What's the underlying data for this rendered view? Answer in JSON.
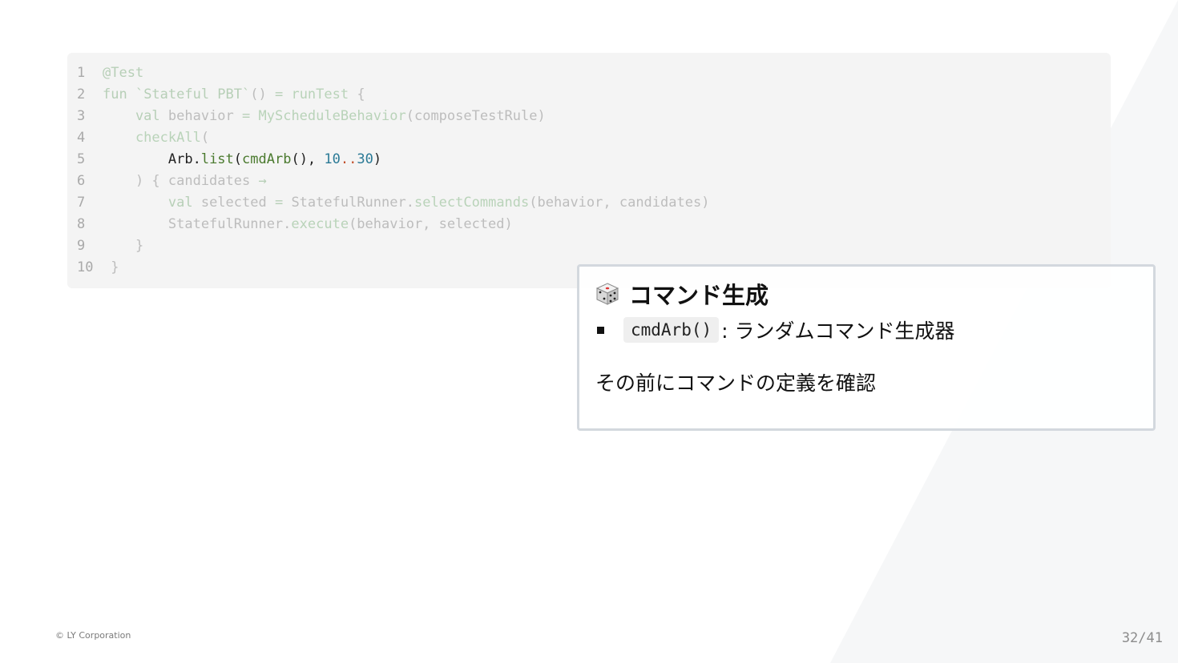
{
  "slide": {
    "copyright": "© LY Corporation",
    "page_number": "32/41"
  },
  "code": {
    "lines": [
      {
        "n": "1",
        "tokens": [
          {
            "t": "@Test",
            "c": "dimk"
          }
        ]
      },
      {
        "n": "2",
        "tokens": [
          {
            "t": "fun ",
            "c": "dimk"
          },
          {
            "t": "`Stateful PBT`",
            "c": "dimk"
          },
          {
            "t": "() ",
            "c": "dim"
          },
          {
            "t": "= ",
            "c": "dimk"
          },
          {
            "t": "runTest",
            "c": "dimfn"
          },
          {
            "t": " {",
            "c": "dim"
          }
        ]
      },
      {
        "n": "3",
        "tokens": [
          {
            "t": "    val ",
            "c": "dimk"
          },
          {
            "t": "behavior ",
            "c": "dim"
          },
          {
            "t": "= ",
            "c": "dimk"
          },
          {
            "t": "MyScheduleBehavior",
            "c": "dimfn"
          },
          {
            "t": "(composeTestRule)",
            "c": "dim"
          }
        ]
      },
      {
        "n": "4",
        "tokens": [
          {
            "t": "    checkAll",
            "c": "dimfn"
          },
          {
            "t": "(",
            "c": "dim"
          }
        ]
      },
      {
        "n": "5",
        "tokens": [
          {
            "t": "        Arb.",
            "c": "hl-plain"
          },
          {
            "t": "list",
            "c": "hl-fn"
          },
          {
            "t": "(",
            "c": "hl-plain"
          },
          {
            "t": "cmdArb",
            "c": "hl-fn"
          },
          {
            "t": "(), ",
            "c": "hl-plain"
          },
          {
            "t": "10",
            "c": "hl-num"
          },
          {
            "t": "..",
            "c": "hl-op"
          },
          {
            "t": "30",
            "c": "hl-num"
          },
          {
            "t": ")",
            "c": "hl-plain"
          }
        ]
      },
      {
        "n": "6",
        "tokens": [
          {
            "t": "    ) { candidates ",
            "c": "dim"
          },
          {
            "t": "→",
            "c": "dimk"
          }
        ]
      },
      {
        "n": "7",
        "tokens": [
          {
            "t": "        val ",
            "c": "dimk"
          },
          {
            "t": "selected ",
            "c": "dim"
          },
          {
            "t": "= ",
            "c": "dimk"
          },
          {
            "t": "StatefulRunner.",
            "c": "dim"
          },
          {
            "t": "selectCommands",
            "c": "dimfn"
          },
          {
            "t": "(behavior, candidates)",
            "c": "dim"
          }
        ]
      },
      {
        "n": "8",
        "tokens": [
          {
            "t": "        StatefulRunner.",
            "c": "dim"
          },
          {
            "t": "execute",
            "c": "dimfn"
          },
          {
            "t": "(behavior, selected)",
            "c": "dim"
          }
        ]
      },
      {
        "n": "9",
        "tokens": [
          {
            "t": "    }",
            "c": "dim"
          }
        ]
      },
      {
        "n": "10",
        "tokens": [
          {
            "t": " }",
            "c": "dim"
          }
        ]
      }
    ]
  },
  "callout": {
    "icon": "dice-icon",
    "title": "コマンド生成",
    "bullet_code": "cmdArb()",
    "bullet_text": ": ランダムコマンド生成器",
    "note": "その前にコマンドの定義を確認"
  }
}
